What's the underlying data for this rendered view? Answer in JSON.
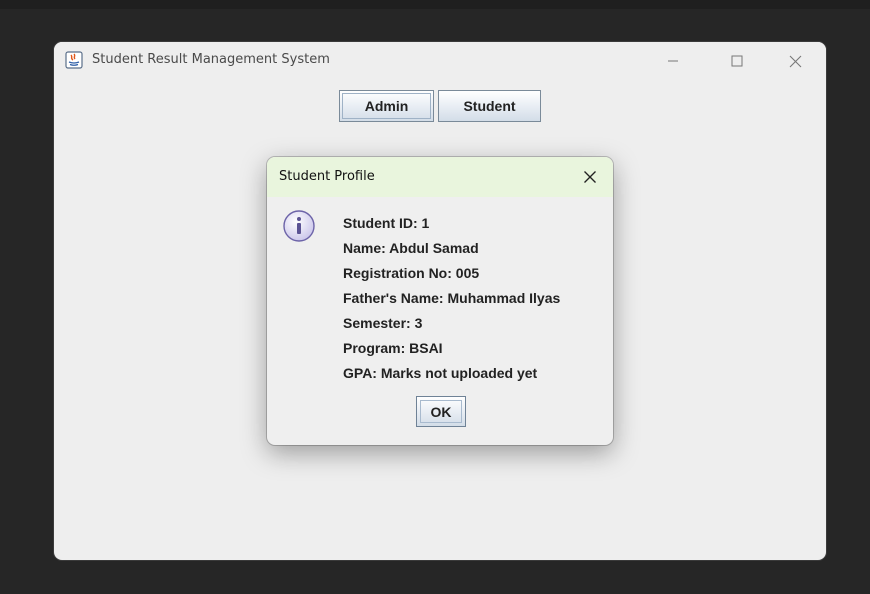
{
  "window": {
    "title": "Student Result Management System"
  },
  "toolbar": {
    "admin_label": "Admin",
    "student_label": "Student"
  },
  "dialog": {
    "title": "Student Profile",
    "lines": [
      "Student ID: 1",
      "Name: Abdul Samad",
      "Registration No: 005",
      "Father's Name: Muhammad Ilyas",
      "Semester: 3",
      "Program: BSAI",
      "GPA: Marks not uploaded yet"
    ],
    "ok_label": "OK"
  },
  "icons": {
    "app": "java-app-icon",
    "minimize": "minimize-icon",
    "maximize": "maximize-icon",
    "close": "close-icon",
    "info": "info-icon"
  },
  "colors": {
    "dialog_title_bg": "#e9f5dd",
    "window_bg": "#eeeeee",
    "desktop_bg": "#262626"
  }
}
